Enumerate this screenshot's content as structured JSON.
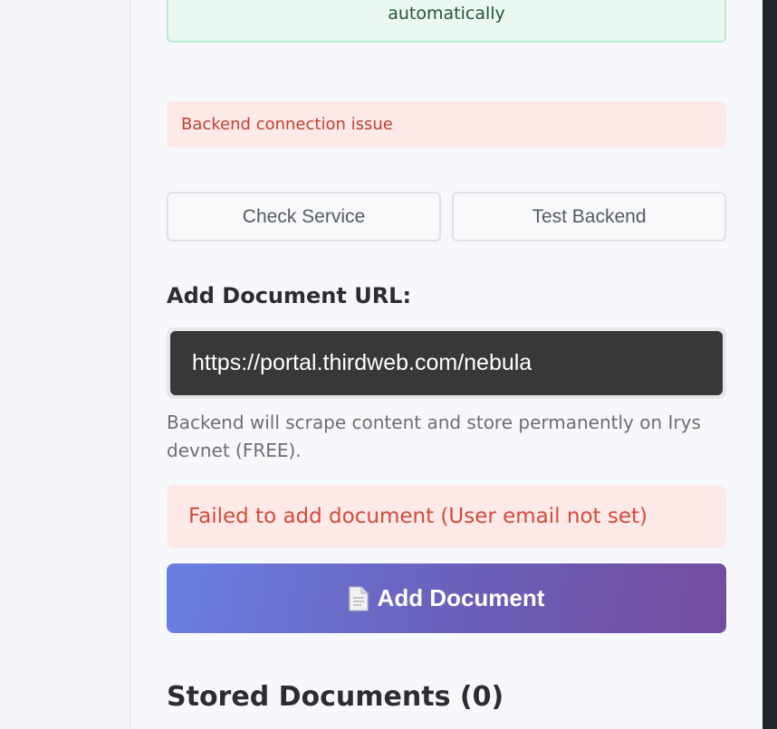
{
  "status": {
    "success_text": "automatically",
    "connection_warning": "Backend connection issue"
  },
  "actions": {
    "check_service_label": "Check Service",
    "test_backend_label": "Test Backend"
  },
  "add_document": {
    "label": "Add Document URL:",
    "url_value": "https://portal.thirdweb.com/nebula",
    "help_text": "Backend will scrape content and store permanently on Irys devnet (FREE).",
    "error_text": "Failed to add document (User email not set)",
    "button_label": "Add Document",
    "button_icon": "document-icon"
  },
  "stored": {
    "title": "Stored Documents (0)"
  },
  "colors": {
    "success_bg": "#ebf8f2",
    "error_bg": "#fde9e8",
    "error_text": "#d24b3a",
    "primary_gradient_start": "#6a7fe3",
    "primary_gradient_end": "#744c9e",
    "input_bg": "#383838"
  }
}
